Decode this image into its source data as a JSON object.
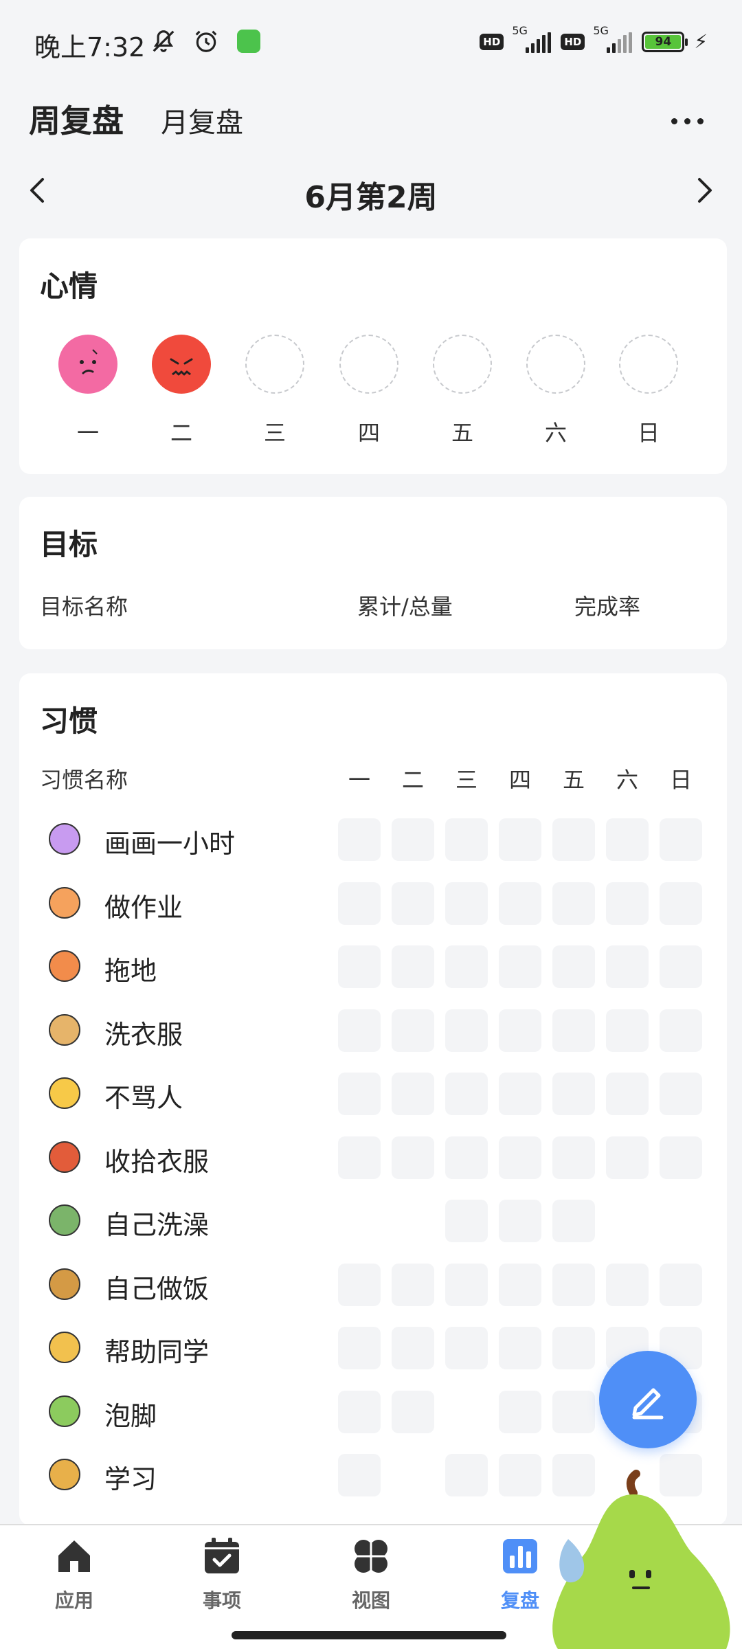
{
  "status_bar": {
    "time": "晚上7:32",
    "icons": [
      "mute-icon",
      "alarm-icon",
      "app-notification-icon"
    ],
    "network_1": {
      "badge": "HD",
      "type": "5G"
    },
    "network_2": {
      "badge": "HD",
      "type": "5G"
    },
    "battery_percent": "94",
    "charging": true
  },
  "header": {
    "tabs": [
      {
        "label": "周复盘",
        "active": true
      },
      {
        "label": "月复盘",
        "active": false
      }
    ],
    "more_icon": "more-icon"
  },
  "week_nav": {
    "label": "6月第2周",
    "prev_icon": "chevron-left-icon",
    "next_icon": "chevron-right-icon"
  },
  "mood": {
    "title": "心情",
    "days": [
      {
        "label": "一",
        "mood": "sad",
        "color": "#f36aa3"
      },
      {
        "label": "二",
        "mood": "angry",
        "color": "#f04a3c"
      },
      {
        "label": "三",
        "mood": null
      },
      {
        "label": "四",
        "mood": null
      },
      {
        "label": "五",
        "mood": null
      },
      {
        "label": "六",
        "mood": null
      },
      {
        "label": "日",
        "mood": null
      }
    ]
  },
  "goals": {
    "title": "目标",
    "columns": [
      "目标名称",
      "累计/总量",
      "完成率"
    ]
  },
  "habits": {
    "title": "习惯",
    "name_header": "习惯名称",
    "days": [
      "一",
      "二",
      "三",
      "四",
      "五",
      "六",
      "日"
    ],
    "items": [
      {
        "name": "画画一小时",
        "icon": "pill-icon",
        "cells": [
          1,
          1,
          1,
          1,
          1,
          1,
          1
        ]
      },
      {
        "name": "做作业",
        "icon": "noodle-bowl-icon",
        "cells": [
          1,
          1,
          1,
          1,
          1,
          1,
          1
        ]
      },
      {
        "name": "拖地",
        "icon": "cocktail-icon",
        "cells": [
          1,
          1,
          1,
          1,
          1,
          1,
          1
        ]
      },
      {
        "name": "洗衣服",
        "icon": "cheese-icon",
        "cells": [
          1,
          1,
          1,
          1,
          1,
          1,
          1
        ]
      },
      {
        "name": "不骂人",
        "icon": "fried-egg-icon",
        "cells": [
          1,
          1,
          1,
          1,
          1,
          1,
          1
        ]
      },
      {
        "name": "收拾衣服",
        "icon": "lobster-icon",
        "cells": [
          1,
          1,
          1,
          1,
          1,
          1,
          1
        ]
      },
      {
        "name": "自己洗澡",
        "icon": "salad-bowl-icon",
        "cells": [
          0,
          0,
          1,
          1,
          1,
          0,
          0
        ]
      },
      {
        "name": "自己做饭",
        "icon": "muffin-icon",
        "cells": [
          1,
          1,
          1,
          1,
          1,
          1,
          1
        ]
      },
      {
        "name": "帮助同学",
        "icon": "boot-icon",
        "cells": [
          1,
          1,
          1,
          1,
          1,
          1,
          1
        ]
      },
      {
        "name": "泡脚",
        "icon": "leaf-icon",
        "cells": [
          1,
          1,
          0,
          1,
          1,
          0,
          1
        ]
      },
      {
        "name": "学习",
        "icon": "lamp-icon",
        "cells": [
          1,
          0,
          1,
          1,
          1,
          0,
          1
        ]
      }
    ]
  },
  "fab": {
    "icon": "pencil-icon"
  },
  "bottom_nav": [
    {
      "label": "应用",
      "icon": "home-icon",
      "active": false
    },
    {
      "label": "事项",
      "icon": "calendar-check-icon",
      "active": false
    },
    {
      "label": "视图",
      "icon": "clover-icon",
      "active": false
    },
    {
      "label": "复盘",
      "icon": "bar-chart-icon",
      "active": true
    }
  ],
  "colors": {
    "accent": "#4f8ff7",
    "background": "#f4f5f7",
    "cell_empty": "#f3f4f6",
    "battery": "#58c43a"
  }
}
